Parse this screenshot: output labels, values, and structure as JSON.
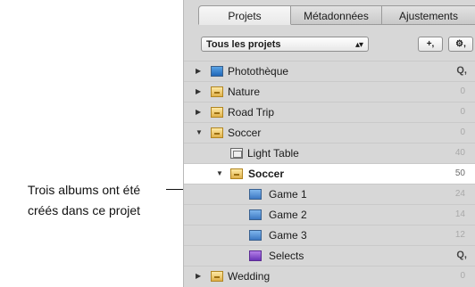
{
  "tabs": [
    {
      "label": "Projets",
      "active": true
    },
    {
      "label": "Métadonnées",
      "active": false
    },
    {
      "label": "Ajustements",
      "active": false
    }
  ],
  "project_filter": {
    "selected": "Tous les projets"
  },
  "toolbar": {
    "add_label": "+,",
    "gear_label": "⚙,"
  },
  "library": {
    "items": [
      {
        "label": "Photothèque",
        "icon": "library-icon",
        "expanded": false,
        "count": "",
        "smart": "Q,"
      },
      {
        "label": "Nature",
        "icon": "project-icon",
        "expanded": false,
        "count": "0"
      },
      {
        "label": "Road Trip",
        "icon": "project-icon",
        "expanded": false,
        "count": "0"
      },
      {
        "label": "Soccer",
        "icon": "project-icon",
        "expanded": true,
        "count": "0"
      },
      {
        "label": "Light Table",
        "icon": "light-table-icon",
        "count": "40"
      },
      {
        "label": "Soccer",
        "icon": "project-icon",
        "expanded": true,
        "count": "50",
        "selected": true
      },
      {
        "label": "Game 1",
        "icon": "album-icon",
        "count": "24"
      },
      {
        "label": "Game 2",
        "icon": "album-icon",
        "count": "14"
      },
      {
        "label": "Game 3",
        "icon": "album-icon",
        "count": "12"
      },
      {
        "label": "Selects",
        "icon": "smart-album-icon",
        "count": "",
        "smart": "Q,"
      },
      {
        "label": "Wedding",
        "icon": "project-icon",
        "expanded": false,
        "count": "0"
      }
    ]
  },
  "annotation": {
    "line1": "Trois albums ont été",
    "line2": "créés dans ce projet"
  }
}
